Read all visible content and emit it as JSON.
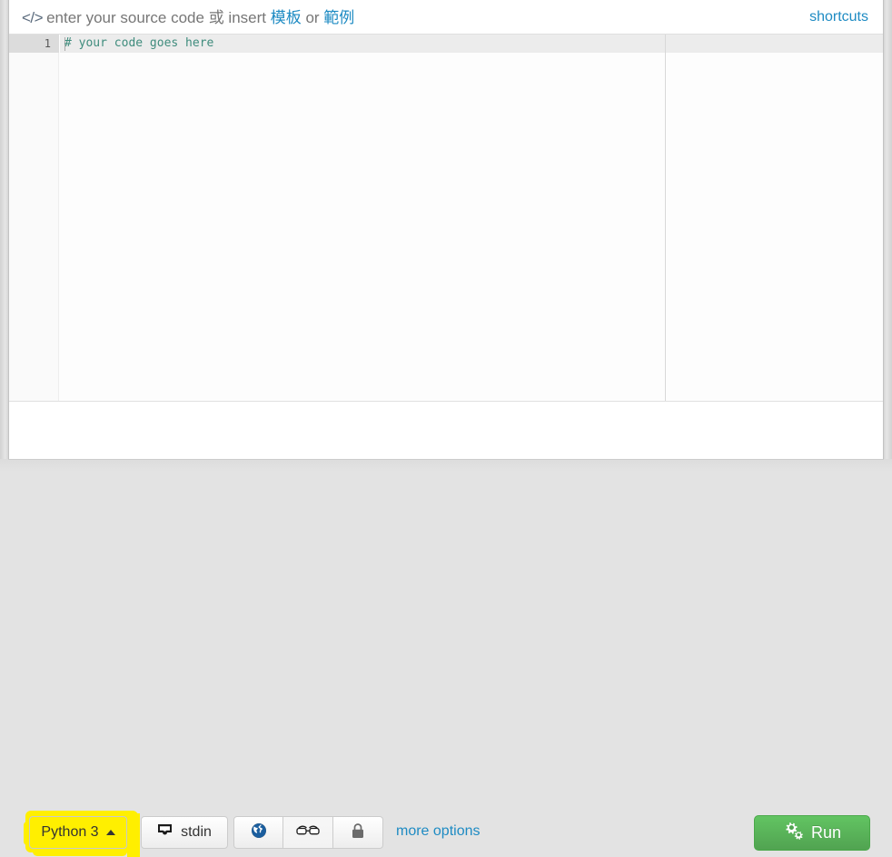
{
  "header": {
    "code_glyph": "</>",
    "title_part1": "enter your source code 或 insert ",
    "template_link": "模板",
    "title_part2": " or ",
    "example_link": "範例",
    "shortcuts_label": "shortcuts"
  },
  "editor": {
    "line_number": "1",
    "code_text": "# your code goes here",
    "comment_color": "#3f8c7d",
    "ruler_column": 722
  },
  "toolbar": {
    "language_label": "Python 3",
    "language_caret": "▲",
    "stdin_label": "stdin",
    "more_options_label": "more options",
    "run_label": "Run",
    "icons": {
      "globe": "globe-icon",
      "glasses": "glasses-icon",
      "lock": "lock-icon",
      "inbox": "inbox-icon",
      "cogs": "cogs-icon"
    }
  },
  "colors": {
    "link": "#1e8bc3",
    "run_green": "#51a351",
    "highlight_yellow": "#ffef00",
    "text_gray": "#777777"
  }
}
